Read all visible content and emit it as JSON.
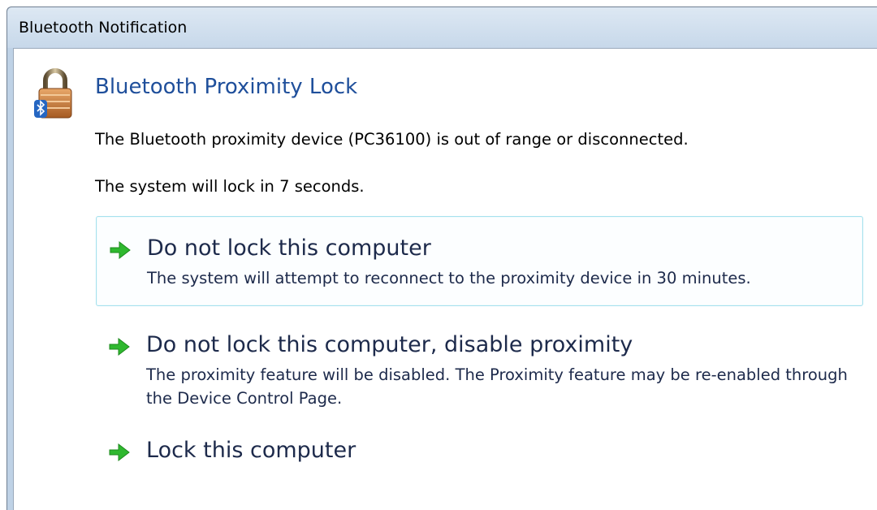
{
  "window": {
    "title": "Bluetooth Notification"
  },
  "dialog": {
    "icon": "bluetooth-padlock-icon",
    "heading": "Bluetooth Proximity Lock",
    "message_line1": "The Bluetooth proximity device (PC36100) is out of range or disconnected.",
    "message_line2": "The system will lock in 7 seconds."
  },
  "options": [
    {
      "icon": "green-arrow-icon",
      "title": "Do not lock this computer",
      "description": "The system will attempt to reconnect to the proximity device in 30 minutes."
    },
    {
      "icon": "green-arrow-icon",
      "title": "Do not lock this computer, disable proximity",
      "description": "The proximity feature will be disabled.  The Proximity feature may be re-enabled through the Device Control Page."
    },
    {
      "icon": "green-arrow-icon",
      "title": "Lock this computer",
      "description": ""
    }
  ],
  "colors": {
    "heading": "#1f4f9b",
    "option_text": "#1d2a4b",
    "hover_border": "#a6e1ee",
    "arrow": "#2fb82f",
    "titlebar": "#c7d8ea"
  }
}
